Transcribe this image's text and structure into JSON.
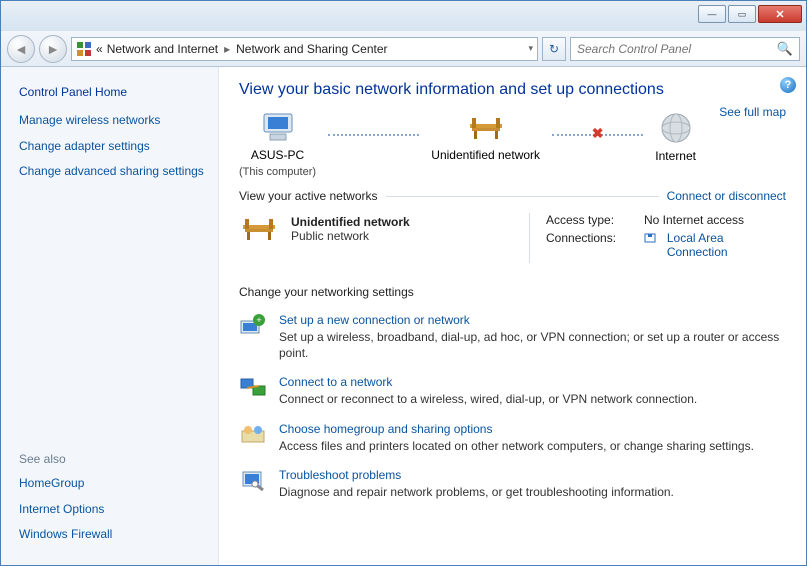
{
  "titlebar": {
    "min": "—",
    "max": "▭",
    "close": "✕"
  },
  "nav": {
    "crumb_root": "«",
    "crumb_parent": "Network and Internet",
    "crumb_current": "Network and Sharing Center",
    "search_placeholder": "Search Control Panel"
  },
  "sidebar": {
    "home": "Control Panel Home",
    "links": [
      "Manage wireless networks",
      "Change adapter settings",
      "Change advanced sharing settings"
    ],
    "seealso_label": "See also",
    "seealso": [
      "HomeGroup",
      "Internet Options",
      "Windows Firewall"
    ]
  },
  "page": {
    "title": "View your basic network information and set up connections",
    "fullmap": "See full map",
    "nodes": {
      "this_pc": "ASUS-PC",
      "this_pc_sub": "(This computer)",
      "middle": "Unidentified network",
      "internet": "Internet"
    },
    "active_label": "View your active networks",
    "connect_link": "Connect or disconnect",
    "network": {
      "name": "Unidentified network",
      "type": "Public network",
      "access_label": "Access type:",
      "access_value": "No Internet access",
      "conn_label": "Connections:",
      "conn_value": "Local Area Connection"
    },
    "settings_label": "Change your networking settings",
    "tasks": [
      {
        "title": "Set up a new connection or network",
        "desc": "Set up a wireless, broadband, dial-up, ad hoc, or VPN connection; or set up a router or access point."
      },
      {
        "title": "Connect to a network",
        "desc": "Connect or reconnect to a wireless, wired, dial-up, or VPN network connection."
      },
      {
        "title": "Choose homegroup and sharing options",
        "desc": "Access files and printers located on other network computers, or change sharing settings."
      },
      {
        "title": "Troubleshoot problems",
        "desc": "Diagnose and repair network problems, or get troubleshooting information."
      }
    ]
  }
}
